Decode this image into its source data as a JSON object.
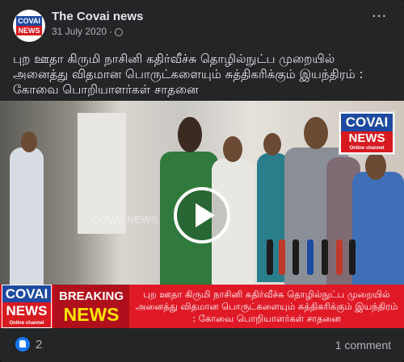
{
  "post": {
    "page_name": "The Covai news",
    "date": "31 July 2020",
    "separator": "·",
    "more_label": "···",
    "caption": "புற ஊதா கிருமி நாசினி கதிர்வீச்சு தொழில்நுட்ப முறையில் அனைத்து விதமான பொருட்களையும் சுத்திகரிக்கும் இயந்திரம் : கோவை பொறியாளர்கள் சாதனை"
  },
  "avatar": {
    "line1": "COVAI",
    "line2": "NEWS"
  },
  "video": {
    "logo_top": "COVAI",
    "logo_bottom": "NEWS",
    "logo_sub": "Online channel",
    "watermark": "COVAI NEWS",
    "ticker_logo_top": "COVAI",
    "ticker_logo_bottom": "NEWS",
    "ticker_logo_sub": "Online channel",
    "breaking_line1": "BREAKING",
    "breaking_line2": "NEWS",
    "ticker_text": "புற ஊதா கிருமி நாசினி கதிர்வீச்சு தொழில்நுட்ப முறையில் அனைத்து விதமான பொருட்களையும் சுத்திகரிக்கும் இயந்திரம் : கோவை பொறியாளர்கள் சாதனை"
  },
  "reactions": {
    "like_count": "2",
    "comments_label": "1 comment"
  },
  "colors": {
    "brand_blue": "#1d4aa0",
    "brand_red": "#d71920",
    "facebook_blue": "#1877f2"
  },
  "icons": {
    "privacy": "globe-icon",
    "play": "play-icon",
    "like": "like-icon"
  }
}
